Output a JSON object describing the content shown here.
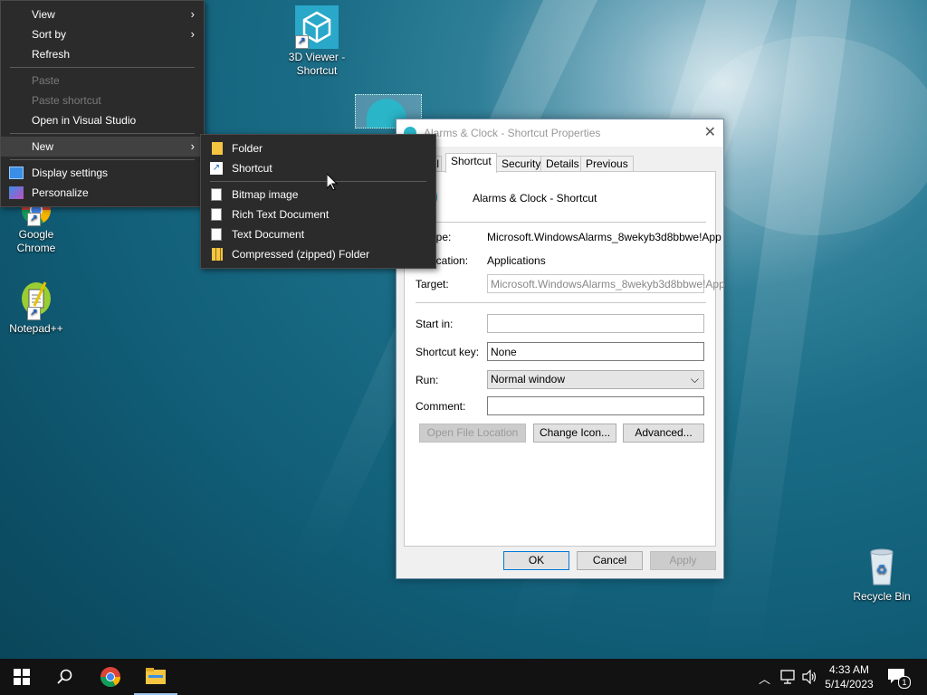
{
  "desktop": {
    "icons": [
      {
        "label": "3D Viewer -\nShortcut"
      },
      {
        "label": "Google\nChrome"
      },
      {
        "label": "Notepad++"
      },
      {
        "label": "Recycle Bin"
      }
    ]
  },
  "context_menu": {
    "view": "View",
    "sort_by": "Sort by",
    "refresh": "Refresh",
    "paste": "Paste",
    "paste_shortcut": "Paste shortcut",
    "open_vs": "Open in Visual Studio",
    "new": "New",
    "display_settings": "Display settings",
    "personalize": "Personalize"
  },
  "new_submenu": {
    "folder": "Folder",
    "shortcut": "Shortcut",
    "bitmap": "Bitmap image",
    "rtf": "Rich Text Document",
    "text": "Text Document",
    "zip": "Compressed (zipped) Folder"
  },
  "dialog": {
    "title": "Alarms & Clock - Shortcut Properties",
    "tabs": [
      "al",
      "Shortcut",
      "Security",
      "Details",
      "Previous Versions"
    ],
    "name": "Alarms & Clock - Shortcut",
    "target_type_label": "et type:",
    "target_type_value": "Microsoft.WindowsAlarms_8wekyb3d8bbwe!App",
    "target_location_label": "et location:",
    "target_location_value": "Applications",
    "target_label": "Target:",
    "target_value": "Microsoft.WindowsAlarms_8wekyb3d8bbwe!App",
    "start_in_label": "Start in:",
    "start_in_value": "",
    "shortcut_key_label": "Shortcut key:",
    "shortcut_key_value": "None",
    "run_label": "Run:",
    "run_value": "Normal window",
    "comment_label": "Comment:",
    "comment_value": "",
    "open_file_location": "Open File Location",
    "change_icon": "Change Icon...",
    "advanced": "Advanced...",
    "ok": "OK",
    "cancel": "Cancel",
    "apply": "Apply"
  },
  "taskbar": {
    "time": "4:33 AM",
    "date": "5/14/2023",
    "notification_count": "1"
  },
  "colors": {
    "menu_bg": "#2b2b2b",
    "taskbar_bg": "#121212",
    "accent": "#1d5fbf"
  }
}
